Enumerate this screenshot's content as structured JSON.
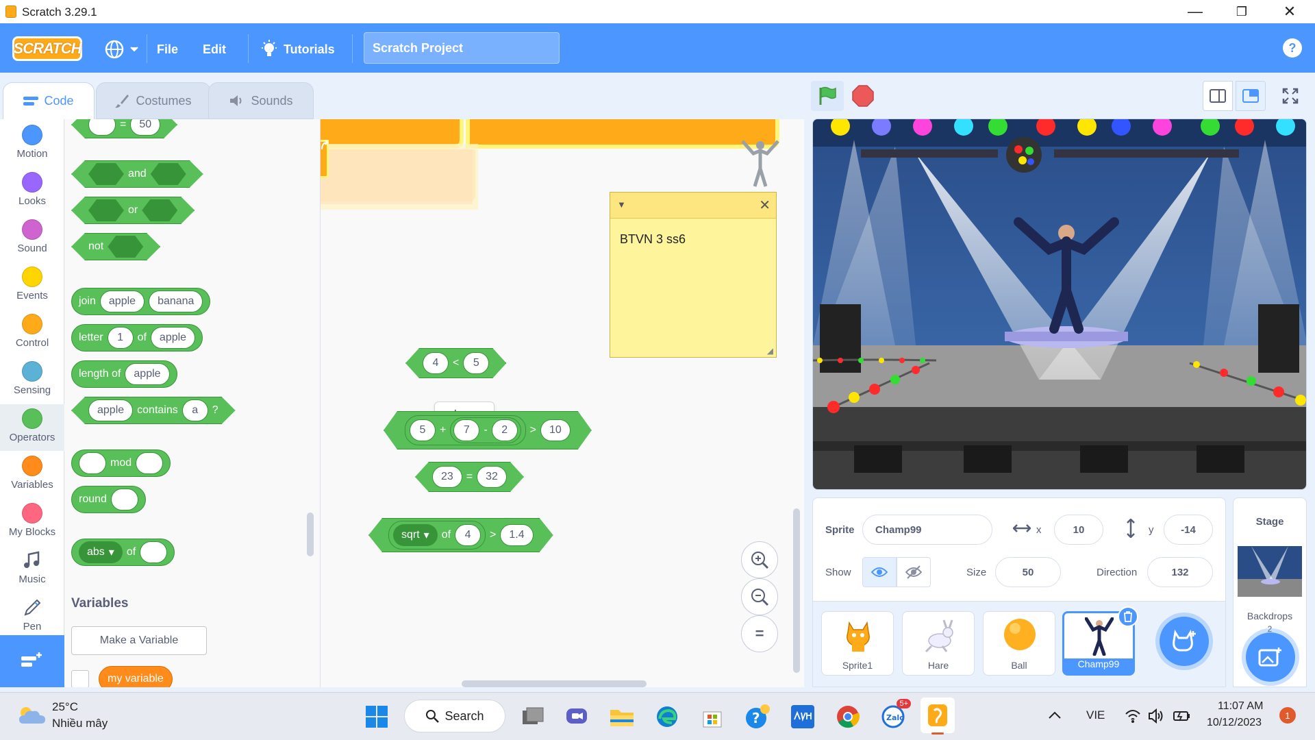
{
  "window": {
    "title": "Scratch 3.29.1",
    "minimize": "—",
    "maximize": "❐",
    "close": "✕"
  },
  "menubar": {
    "logo": "SCRATCH",
    "language_icon": "globe-icon",
    "file": "File",
    "edit": "Edit",
    "tutorials": "Tutorials",
    "project_title": "Scratch Project",
    "help": "?"
  },
  "tabs": [
    {
      "label": "Code",
      "icon": "code-icon",
      "active": true
    },
    {
      "label": "Costumes",
      "icon": "brush-icon",
      "active": false
    },
    {
      "label": "Sounds",
      "icon": "speaker-icon",
      "active": false
    }
  ],
  "categories": [
    {
      "label": "Motion",
      "color": "#4c97ff"
    },
    {
      "label": "Looks",
      "color": "#9966ff"
    },
    {
      "label": "Sound",
      "color": "#cf63cf"
    },
    {
      "label": "Events",
      "color": "#ffd500"
    },
    {
      "label": "Control",
      "color": "#ffab19"
    },
    {
      "label": "Sensing",
      "color": "#5cb1d6"
    },
    {
      "label": "Operators",
      "color": "#59c059"
    },
    {
      "label": "Variables",
      "color": "#ff8c1a"
    },
    {
      "label": "My Blocks",
      "color": "#ff6680"
    },
    {
      "label": "Music",
      "color": "#0fbd8c"
    },
    {
      "label": "Pen",
      "color": "#0fbd8c"
    }
  ],
  "palette": {
    "equals_block": {
      "op": "=",
      "right": "50"
    },
    "and_block": "and",
    "or_block": "or",
    "not_block": "not",
    "join_block": {
      "label": "join",
      "a": "apple",
      "b": "banana"
    },
    "letter_block": {
      "label": "letter",
      "n": "1",
      "of": "of",
      "word": "apple"
    },
    "length_block": {
      "label": "length of",
      "word": "apple"
    },
    "contains_block": {
      "a": "apple",
      "label": "contains",
      "b": "a",
      "q": "?"
    },
    "mod_block": "mod",
    "round_block": "round",
    "abs_block": {
      "fn": "abs",
      "of": "of"
    },
    "variables_heading": "Variables",
    "make_variable": "Make a Variable",
    "my_variable": "my variable"
  },
  "script": {
    "note_text": "BTVN 3 ss6",
    "lt_block": {
      "a": "4",
      "op": "<",
      "b": "5"
    },
    "tooltip": "true",
    "gt_block": {
      "a": "5",
      "plus": "+",
      "b": "7",
      "minus": "-",
      "c": "2",
      "op": ">",
      "d": "10"
    },
    "eq_block": {
      "a": "23",
      "op": "=",
      "b": "32"
    },
    "sqrt_block": {
      "fn": "sqrt",
      "of": "of",
      "n": "4",
      "op": ">",
      "m": "1.4"
    },
    "zoom_in": "+",
    "zoom_out": "−",
    "zoom_reset": "="
  },
  "sprite_info": {
    "sprite_label": "Sprite",
    "sprite_name": "Champ99",
    "x_label": "x",
    "x": "10",
    "y_label": "y",
    "y": "-14",
    "show_label": "Show",
    "size_label": "Size",
    "size": "50",
    "direction_label": "Direction",
    "direction": "132"
  },
  "sprites": [
    {
      "name": "Sprite1",
      "selected": false
    },
    {
      "name": "Hare",
      "selected": false
    },
    {
      "name": "Ball",
      "selected": false
    },
    {
      "name": "Champ99",
      "selected": true
    }
  ],
  "stage_panel": {
    "title": "Stage",
    "backdrops_label": "Backdrops",
    "backdrops_count": "2"
  },
  "taskbar": {
    "weather_temp": "25°C",
    "weather_desc": "Nhiều mây",
    "search": "Search",
    "zalo_badge": "5+",
    "language": "VIE",
    "time": "11:07 AM",
    "date": "10/12/2023",
    "notification_count": "1"
  }
}
